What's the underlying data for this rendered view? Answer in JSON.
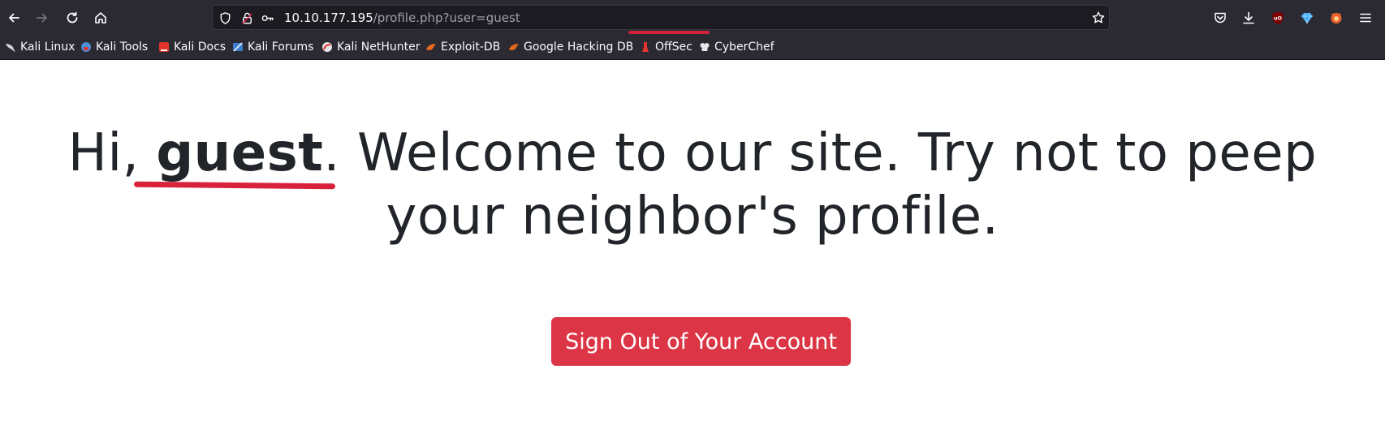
{
  "browser": {
    "url_host": "10.10.177.195",
    "url_path": "/profile.php?user=guest",
    "icons": {
      "back": "back-arrow-icon",
      "forward": "forward-arrow-icon",
      "reload": "reload-icon",
      "home": "home-icon",
      "shield": "shield-icon",
      "lock": "insecure-lock-icon",
      "key": "key-icon",
      "star": "bookmark-star-icon",
      "pocket": "pocket-icon",
      "download": "download-icon",
      "ublock": "ublock-origin-icon",
      "gem": "extension-gem-icon",
      "fox": "foxyproxy-icon",
      "menu": "hamburger-menu-icon"
    }
  },
  "bookmarks": [
    {
      "label": "Kali Linux",
      "icon": "kali-dragon-icon",
      "color": "#367bf0"
    },
    {
      "label": "Kali Tools",
      "icon": "kali-tools-icon",
      "color": "#4a90d9"
    },
    {
      "label": "Kali Docs",
      "icon": "kali-docs-icon",
      "color": "#e0332c"
    },
    {
      "label": "Kali Forums",
      "icon": "kali-forums-icon",
      "color": "#3f7fd6"
    },
    {
      "label": "Kali NetHunter",
      "icon": "kali-nethunter-icon",
      "color": "#d33"
    },
    {
      "label": "Exploit-DB",
      "icon": "exploit-db-icon",
      "color": "#e86a1c"
    },
    {
      "label": "Google Hacking DB",
      "icon": "ghdb-icon",
      "color": "#e86a1c"
    },
    {
      "label": "OffSec",
      "icon": "offsec-icon",
      "color": "#e0332c"
    },
    {
      "label": "CyberChef",
      "icon": "cyberchef-icon",
      "color": "#dddddd"
    }
  ],
  "page": {
    "greeting": "Hi,",
    "username": "guest",
    "message_rest": ". Welcome to our site. Try not to peep your neighbor's profile.",
    "signout_label": "Sign Out of Your Account",
    "accent_color": "#dc3545",
    "annotation_color": "#d8223c"
  }
}
